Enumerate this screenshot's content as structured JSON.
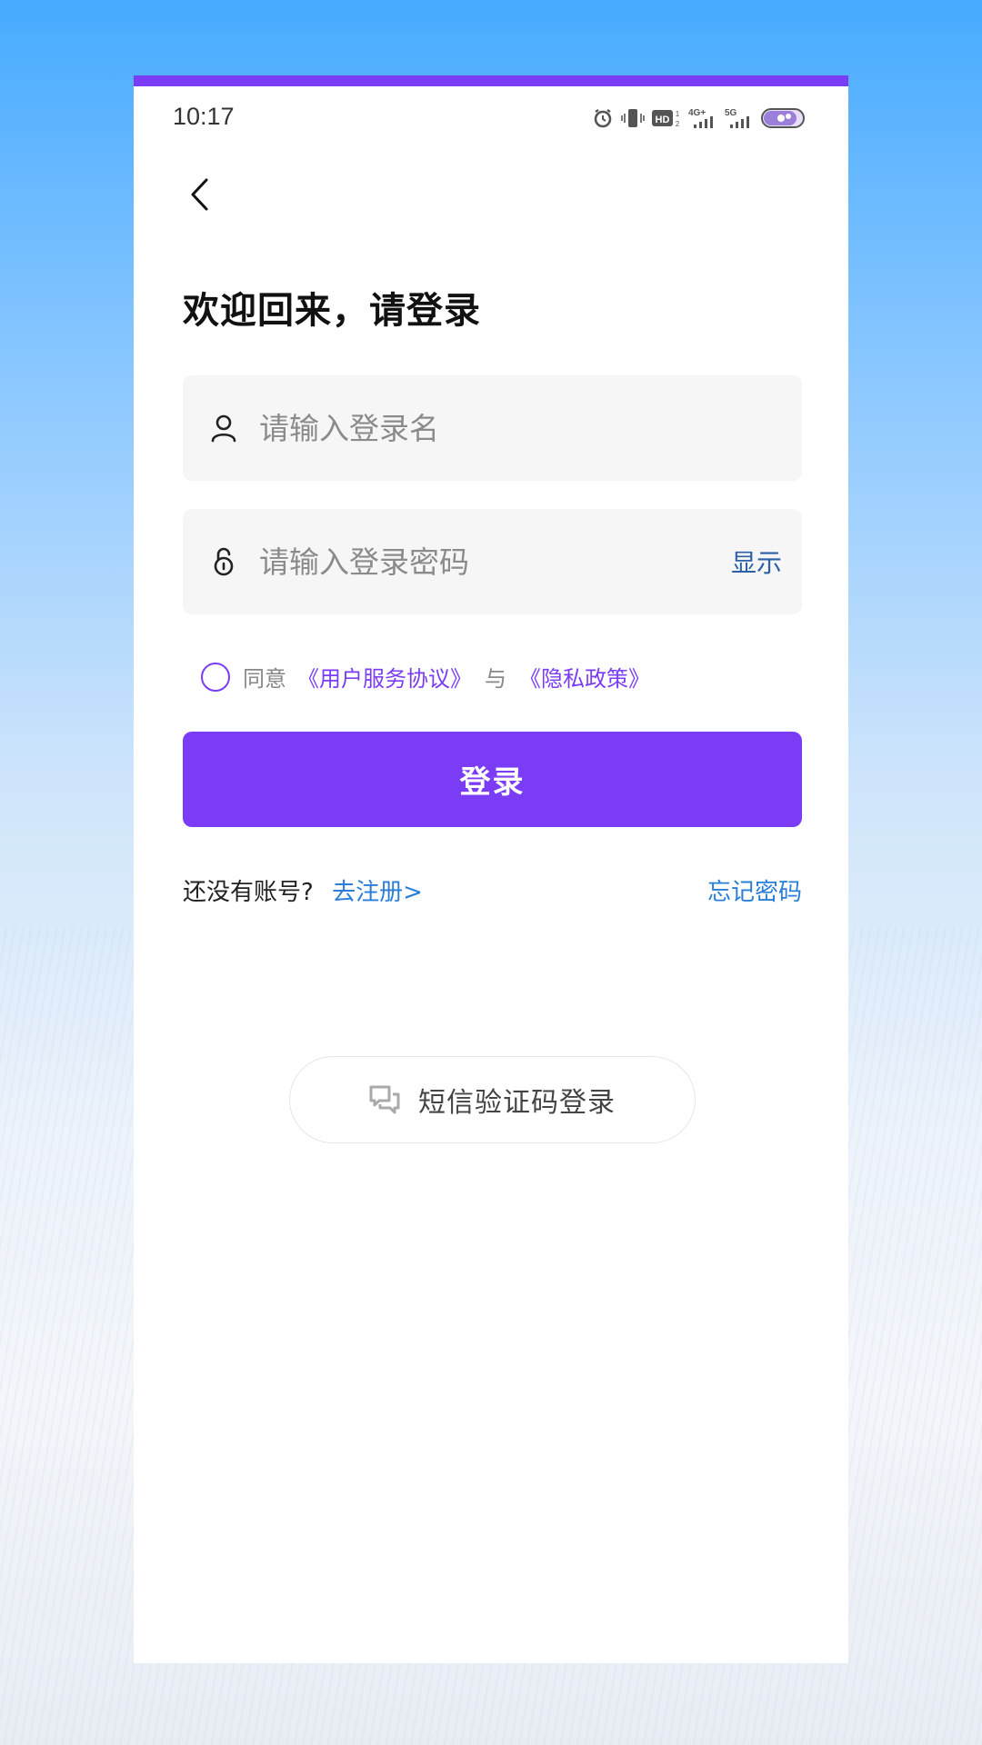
{
  "status_bar": {
    "time": "10:17",
    "icons": [
      "alarm-icon",
      "vibrate-icon",
      "hd-icon",
      "4g-signal-icon",
      "5g-signal-icon",
      "battery-icon"
    ]
  },
  "header": {
    "back_icon": "chevron-left-icon",
    "title": "欢迎回来，请登录"
  },
  "form": {
    "username": {
      "placeholder": "请输入登录名",
      "value": "",
      "icon": "user-icon"
    },
    "password": {
      "placeholder": "请输入登录密码",
      "value": "",
      "icon": "lock-icon",
      "show_label": "显示"
    }
  },
  "agreement": {
    "checked": false,
    "prefix": "同意",
    "terms_link": "《用户服务协议》",
    "conjunction": "与",
    "privacy_link": "《隐私政策》"
  },
  "login_button": {
    "label": "登录"
  },
  "links": {
    "no_account": "还没有账号?",
    "register": "去注册>",
    "forgot": "忘记密码"
  },
  "sms_login": {
    "label": "短信验证码登录",
    "icon": "message-icon"
  },
  "colors": {
    "accent": "#7a3cf5",
    "link_blue": "#2a7ed8",
    "show_blue": "#2b5fa6"
  }
}
